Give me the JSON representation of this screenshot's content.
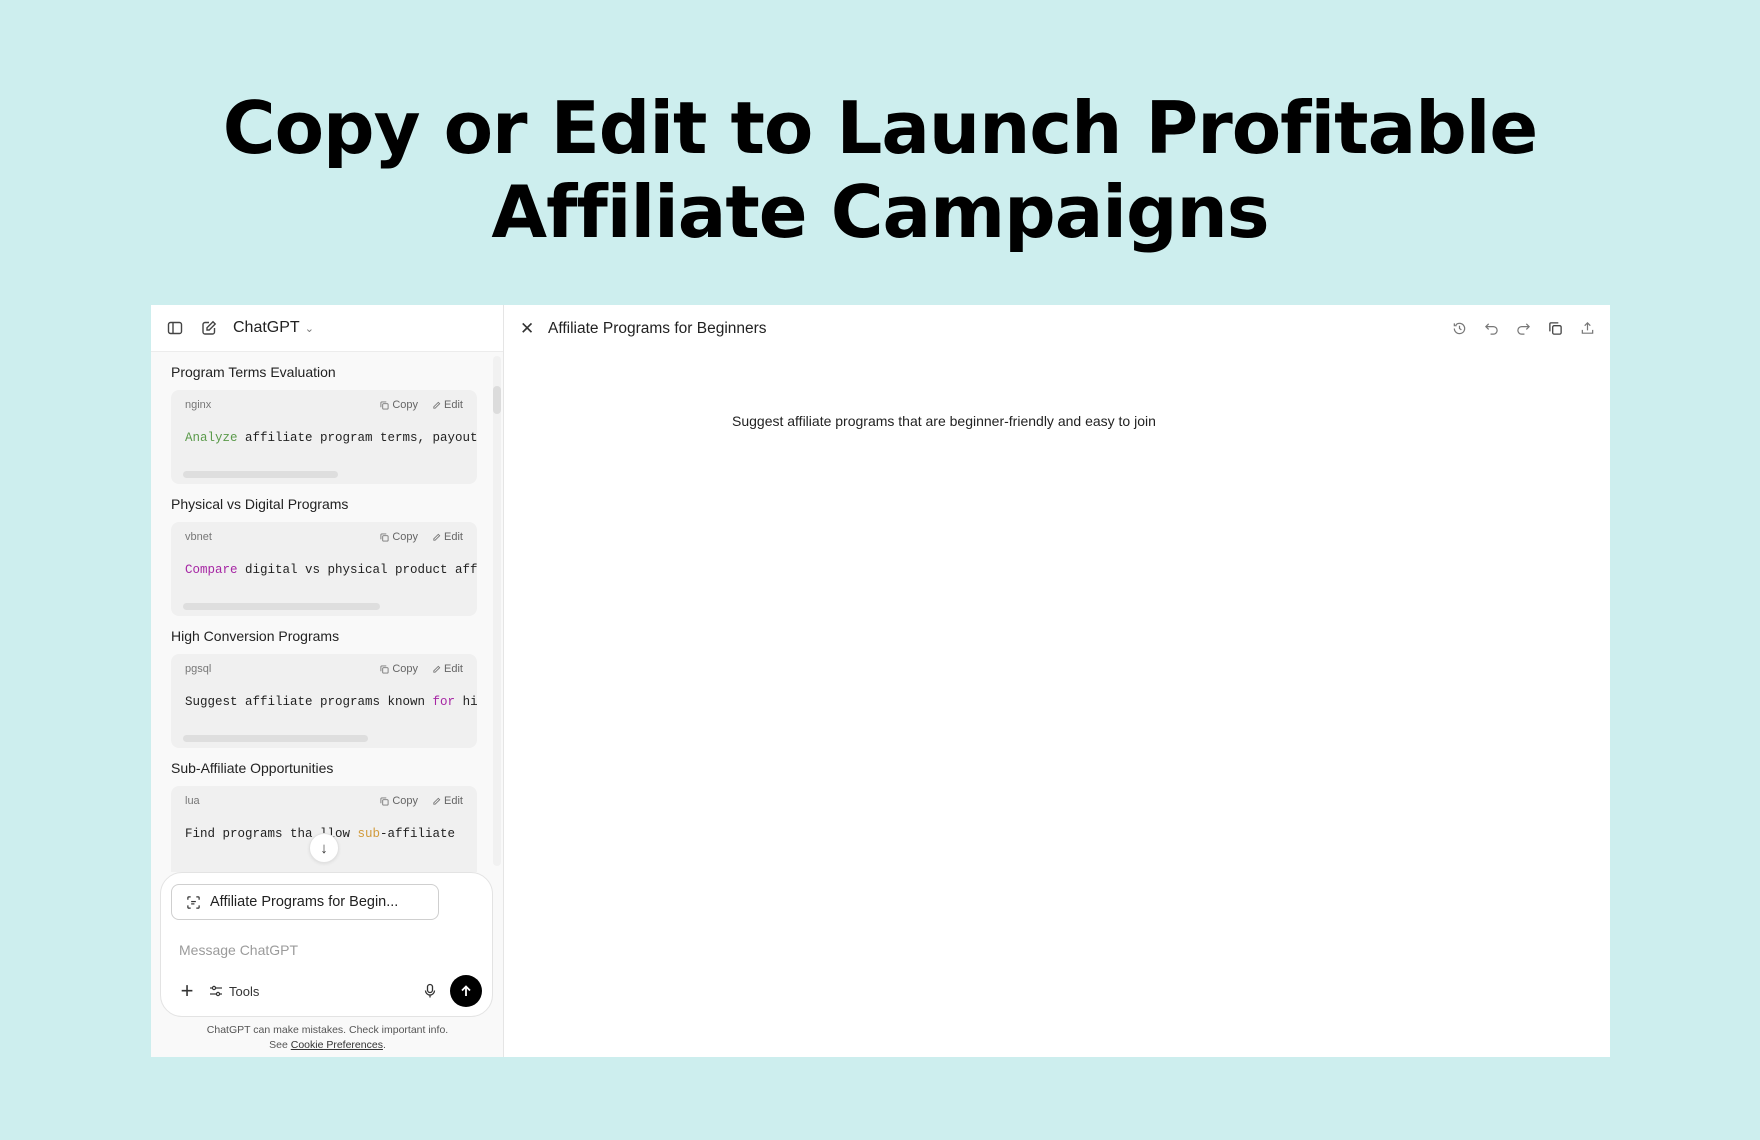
{
  "headline": {
    "line1": "Copy or Edit to Launch Profitable",
    "line2": "Affiliate Campaigns"
  },
  "chat": {
    "model": "ChatGPT",
    "sections": [
      {
        "title": "Program Terms Evaluation",
        "lang": "nginx",
        "copy_label": "Copy",
        "edit_label": "Edit",
        "code_keyword": "Analyze",
        "code_keyword_color": "#5a9a4a",
        "code_rest": " affiliate program terms, payout",
        "scroll_fraction": 0.58
      },
      {
        "title": "Physical vs Digital Programs",
        "lang": "vbnet",
        "copy_label": "Copy",
        "edit_label": "Edit",
        "code_keyword": "Compare",
        "code_keyword_color": "#a626a4",
        "code_rest": " digital vs physical product aff",
        "scroll_fraction": 0.66
      },
      {
        "title": "High Conversion Programs",
        "lang": "pgsql",
        "copy_label": "Copy",
        "edit_label": "Edit",
        "code_pre": "Suggest affiliate programs known ",
        "code_keyword": "for",
        "code_keyword_color": "#a626a4",
        "code_rest": " hi",
        "scroll_fraction": 0.62
      },
      {
        "title": "Sub-Affiliate Opportunities",
        "lang": "lua",
        "copy_label": "Copy",
        "edit_label": "Edit",
        "code_pre": "Find programs tha  llow ",
        "code_keyword": "sub",
        "code_keyword_color": "#d19a3a",
        "code_rest": "-affiliate"
      }
    ],
    "composer": {
      "attachment": "Affiliate Programs for Begin...",
      "placeholder": "Message ChatGPT",
      "tools_label": "Tools"
    },
    "disclaimer": {
      "line1": "ChatGPT can make mistakes. Check important info.",
      "see": "See",
      "link": "Cookie Preferences",
      "end": "."
    }
  },
  "canvas": {
    "title": "Affiliate Programs for Beginners",
    "body": "Suggest affiliate programs that are beginner-friendly and easy to join"
  }
}
